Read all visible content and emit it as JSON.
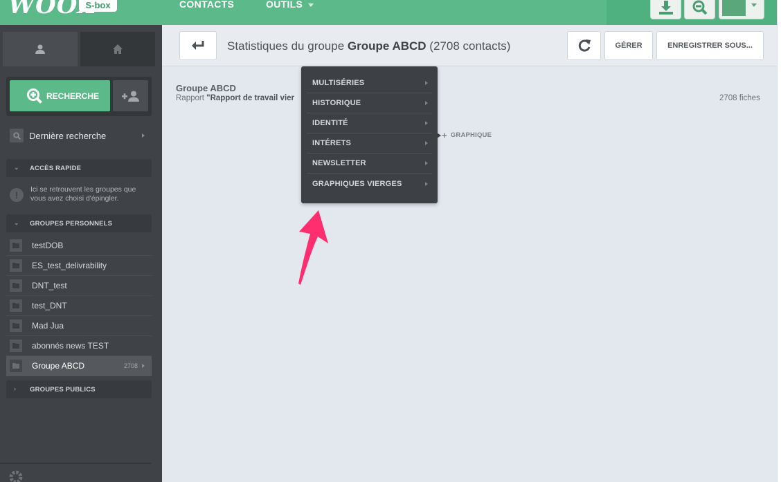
{
  "topbar": {
    "logo_text": "WOOX",
    "badge": "S-box",
    "nav": [
      {
        "label": "CONTACTS"
      },
      {
        "label": "OUTILS"
      }
    ]
  },
  "sidebar": {
    "search_button": "RECHERCHE",
    "last_search": "Dernière recherche",
    "quick_access": {
      "title": "ACCÈS RAPIDE",
      "info": "Ici se retrouvent les groupes que vous avez choisi d'épingler."
    },
    "personal_groups": {
      "title": "GROUPES PERSONNELS",
      "items": [
        {
          "label": "testDOB"
        },
        {
          "label": "ES_test_delivrability"
        },
        {
          "label": "DNT_test"
        },
        {
          "label": "test_DNT"
        },
        {
          "label": "Mad Jua"
        },
        {
          "label": "abonnés news TEST"
        },
        {
          "label": "Groupe ABCD",
          "count": "2708"
        }
      ]
    },
    "public_groups": {
      "title": "GROUPES PUBLICS"
    }
  },
  "header": {
    "title_prefix": "Statistiques du groupe",
    "title_group": "Groupe ABCD",
    "title_suffix": "(2708 contacts)",
    "manage_label": "GÉRER",
    "save_as_label": "ENREGISTRER SOUS..."
  },
  "main": {
    "group_name": "Groupe ABCD",
    "report_prefix": "Rapport",
    "report_name": "\"Rapport de travail vier",
    "fiches": "2708 fiches",
    "add_graph_label": "GRAPHIQUE"
  },
  "dropdown": {
    "items": [
      {
        "label": "MULTISÉRIES"
      },
      {
        "label": "HISTORIQUE"
      },
      {
        "label": "IDENTITÉ"
      },
      {
        "label": "INTÉRETS"
      },
      {
        "label": "NEWSLETTER"
      },
      {
        "label": "GRAPHIQUES VIERGES"
      }
    ]
  },
  "colors": {
    "brand_green": "#5cb98a",
    "sidebar_bg": "#3f4347",
    "annotation_arrow": "#ff2e6e"
  }
}
